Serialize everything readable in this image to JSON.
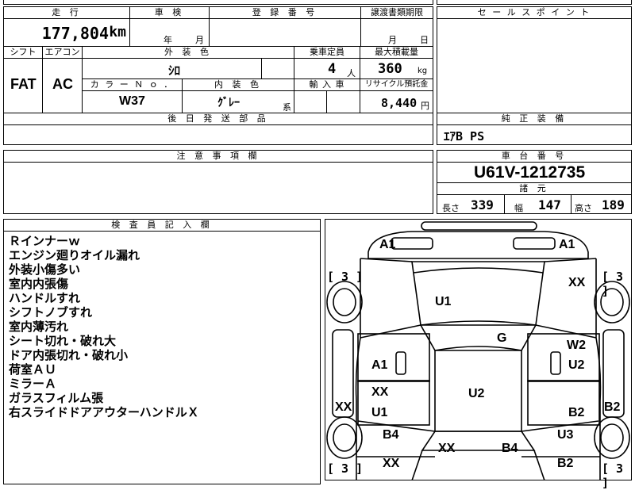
{
  "mileage": {
    "header": "走 行",
    "value": "177,804",
    "unit": "km"
  },
  "inspection": {
    "header": "車 検",
    "year_label": "年",
    "month_label": "月"
  },
  "registration": {
    "header": "登 録 番 号"
  },
  "transfer": {
    "header": "譲渡書類期限",
    "month_label": "月",
    "day_label": "日"
  },
  "sales_point": {
    "header": "セ ー ル ス ポ イ ン ト"
  },
  "shift": {
    "header": "シフト",
    "value": "FAT"
  },
  "aircon": {
    "header": "エアコン",
    "value": "AC"
  },
  "exterior_color": {
    "header": "外 装 色",
    "value": "ｼﾛ"
  },
  "capacity": {
    "header": "乗車定員",
    "value": "4",
    "unit": "人"
  },
  "max_load": {
    "header": "最大積載量",
    "value": "360",
    "unit": "kg"
  },
  "color_no": {
    "header": "カ ラ ー Ｎ ｏ ．",
    "value": "W37"
  },
  "interior_color": {
    "header": "内 装 色",
    "value": "ｸﾞﾚｰ",
    "unit": "系"
  },
  "import": {
    "header": "輸 入 車"
  },
  "recycle": {
    "header": "リサイクル預託金",
    "value": "8,440",
    "unit": "円"
  },
  "later_parts": {
    "header": "後 日 発 送 部 品"
  },
  "equipment": {
    "header": "純 正 装 備",
    "value": "ｴｱB PS"
  },
  "caution": {
    "header": "注 意 事 項 欄"
  },
  "chassis": {
    "header": "車 台 番 号",
    "value": "U61V-1212735"
  },
  "specs": {
    "header": "諸 元",
    "length_label": "長さ",
    "length": "339",
    "width_label": "幅",
    "width": "147",
    "height_label": "高さ",
    "height": "189"
  },
  "inspector": {
    "header": "検 査 員 記 入 欄",
    "remarks": [
      "Ｒインナーｗ",
      "エンジン廻りオイル漏れ",
      "外装小傷多い",
      "室内内張傷",
      "ハンドルすれ",
      "シフトノブすれ",
      "室内薄汚れ",
      "シート切れ・破れ大",
      "ドア内張切れ・破れ小",
      "荷室ＡＵ",
      "ミラーＡ",
      "ガラスフィルム張",
      "右スライドドアアウターハンドルＸ"
    ]
  },
  "damage": {
    "a1_front_left": "A1",
    "a1_front_right": "A1",
    "xx_front_right": "XX",
    "u1_hood": "U1",
    "g_windshield": "G",
    "w2_right": "W2",
    "a1_left": "A1",
    "u2_right": "U2",
    "xx_left_door": "XX",
    "u2_roof": "U2",
    "u1_left_door": "U1",
    "b2_right_door": "B2",
    "xx_left_edge": "XX",
    "b2_right_edge": "B2",
    "b4_left": "B4",
    "u3_right": "U3",
    "xx_rear_mid": "XX",
    "b4_rear": "B4",
    "xx_rear_left": "XX",
    "b2_rear_right": "B2"
  },
  "tires": {
    "fl": "[ 3 ]",
    "fr": "[ 3 ]",
    "rl": "[ 3 ]",
    "rr": "[ 3 ]"
  }
}
